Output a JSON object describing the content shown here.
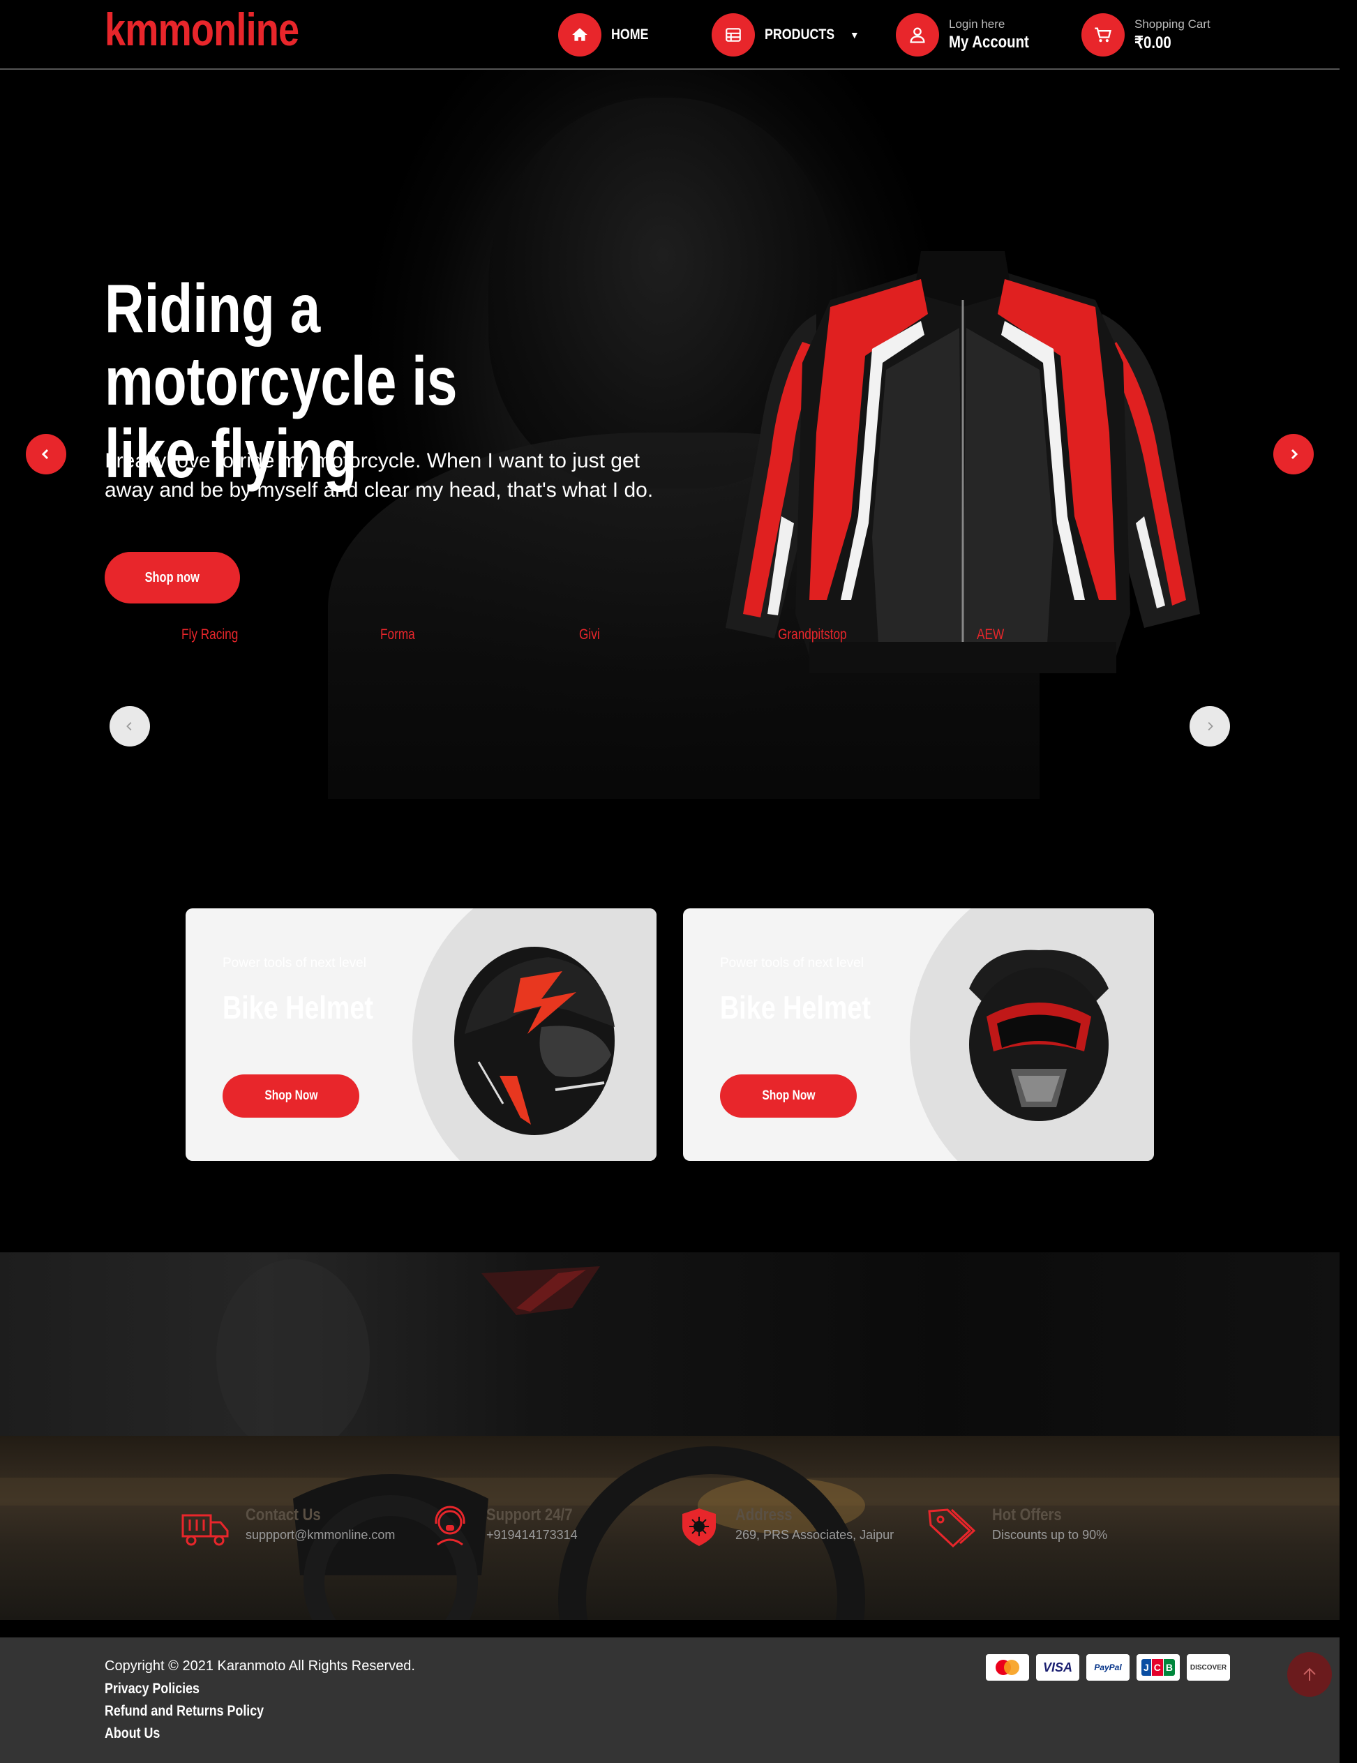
{
  "header": {
    "logo": "kmmonline",
    "nav": {
      "home": "HOME",
      "products": "PRODUCTS",
      "account_small": "Login here",
      "account_big": "My Account",
      "cart_small": "Shopping Cart",
      "cart_big": "₹0.00"
    }
  },
  "hero": {
    "title": "Riding a motorcycle is like flying",
    "text": "I really love to ride my motorcycle. When I want to just get away and be by myself and clear my head, that's what I do.",
    "button": "Shop now",
    "brands": [
      "Fly Racing",
      "Forma",
      "Givi",
      "Grandpitstop",
      "AEW"
    ]
  },
  "promos": [
    {
      "subtitle": "Power tools of next level",
      "title": "Bike Helmet",
      "button": "Shop Now"
    },
    {
      "subtitle": "Power tools of next level",
      "title": "Bike Helmet",
      "button": "Shop Now"
    }
  ],
  "features": [
    {
      "title": "Contact Us",
      "desc": "suppport@kmmonline.com",
      "icon": "truck-icon"
    },
    {
      "title": "Support 24/7",
      "desc": "+919414173314",
      "icon": "support-headset-icon"
    },
    {
      "title": "Address",
      "desc": "269, PRS Associates, Jaipur",
      "icon": "shield-icon"
    },
    {
      "title": "Hot Offers",
      "desc": "Discounts up to 90%",
      "icon": "tag-icon"
    }
  ],
  "footer": {
    "copyright": "Copyright © 2021 Karanmoto All Rights Reserved.",
    "links": [
      "Privacy Policies",
      "Refund and Returns Policy",
      "About Us"
    ],
    "payments": [
      "MasterCard",
      "VISA",
      "PayPal",
      "JCB",
      "DISCOVER"
    ]
  },
  "colors": {
    "accent": "#e8262b",
    "background": "#000000",
    "footer": "#343434"
  }
}
